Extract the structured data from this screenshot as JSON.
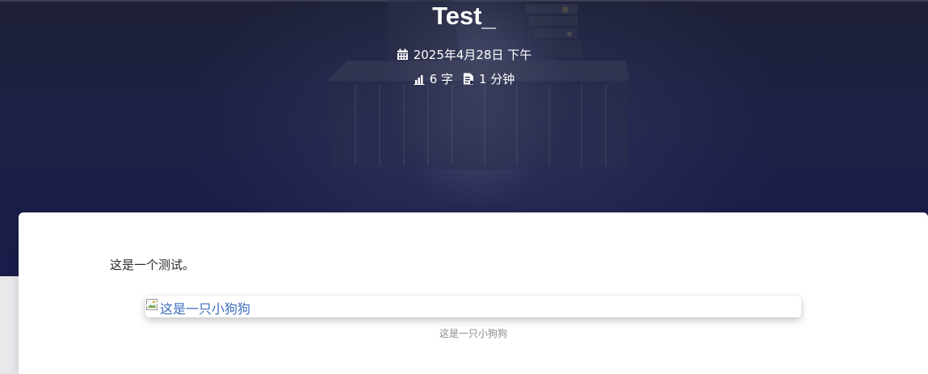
{
  "post": {
    "title": "Test",
    "cursor": "_",
    "date": "2025年4月28日 下午",
    "word_count": "6 字",
    "read_time": "1 分钟"
  },
  "icons": {
    "date": "calendar-icon",
    "word_count": "bar-chart-icon",
    "read_time": "document-icon",
    "image": "broken-image-icon"
  },
  "content": {
    "paragraph": "这是一个测试。",
    "image_alt": "这是一只小狗狗",
    "image_caption": "这是一只小狗狗"
  },
  "colors": {
    "banner": "#1c2045",
    "link": "#3f6fbf",
    "caption": "#8a8a8a"
  }
}
